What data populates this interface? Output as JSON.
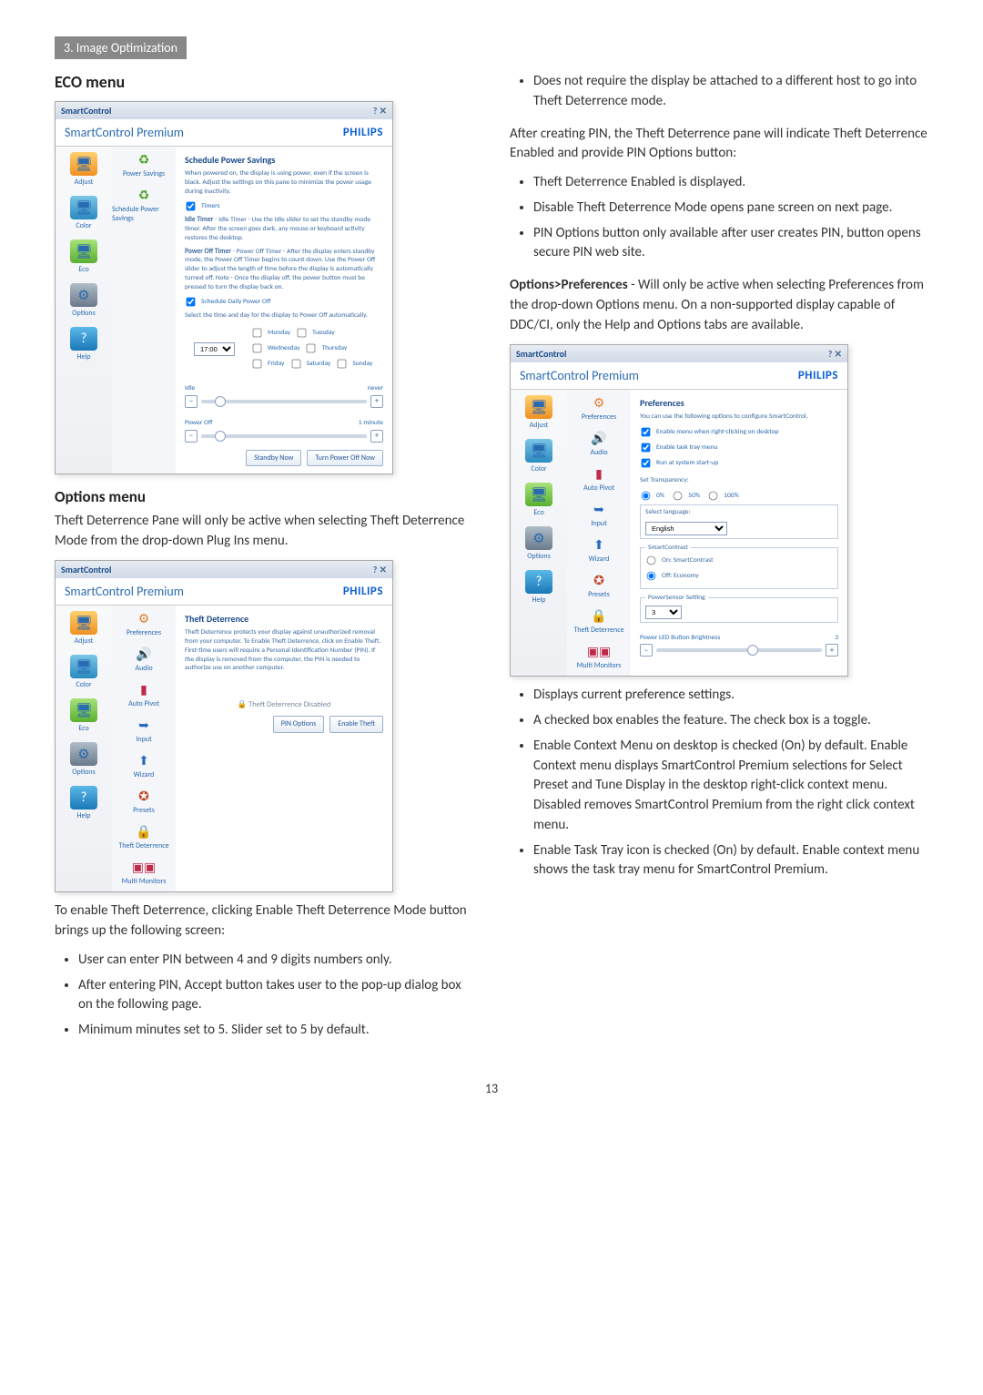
{
  "section_tag": "3. Image Optimization",
  "left": {
    "eco_heading": "ECO menu",
    "options_heading": "Options menu",
    "options_para": "Theft Deterrence Pane will only be active when selecting Theft Deterrence Mode from the drop-down Plug Ins menu.",
    "enable_para": "To enable Theft Deterrence, clicking Enable Theft Deterrence Mode button brings up the following screen:",
    "bullets": [
      "User can enter PIN between 4 and 9 digits numbers only.",
      "After entering PIN, Accept button takes user to the pop-up dialog box on the following page.",
      "Minimum minutes set to 5. Slider set to 5 by default."
    ]
  },
  "right": {
    "top_bullet": "Does not require the display be attached to a different host to go into Theft Deterrence mode.",
    "after_pin_para": "After creating PIN, the Theft Deterrence pane will indicate Theft Deterrence Enabled and provide PIN Options button:",
    "pin_bullets": [
      "Theft Deterrence Enabled is displayed.",
      "Disable Theft Deterrence Mode opens pane screen on next page.",
      "PIN Options button only available after user creates PIN, button opens secure PIN web site."
    ],
    "opts_pref_label": "Options>Preferences",
    "opts_pref_rest": " - Will only be active when selecting Preferences from the drop-down Options menu. On a non-supported display capable of DDC/CI, only the Help and Options tabs are available.",
    "pref_bullets": [
      "Displays current preference settings.",
      "A checked box enables the feature. The check box is a toggle.",
      "Enable Context Menu on desktop is checked (On) by default. Enable Context menu displays SmartControl Premium selections for Select Preset and Tune Display in the desktop right-click context menu. Disabled removes SmartControl Premium from the right click context menu.",
      "Enable Task Tray icon is checked (On) by default. Enable context menu shows the task tray menu for SmartControl Premium."
    ]
  },
  "page_number": "13",
  "app_common": {
    "titlebar": "SmartControl",
    "titlebar_right": "?  ✕",
    "product": "SmartControl Premium",
    "brand": "PHILIPS",
    "sidebar": {
      "adjust": "Adjust",
      "color": "Color",
      "eco": "Eco",
      "options": "Options",
      "help": "Help"
    }
  },
  "eco_panel": {
    "sub_item1": "Power Savings",
    "sub_item2": "Schedule Power Savings",
    "heading": "Schedule Power Savings",
    "p1": "When powered on, the display is using power, even if the screen is black. Adjust the settings on this pane to minimize the power usage during inactivity.",
    "timers_cb": "Timers",
    "idle": "Idle Timer - Use the Idle slider to set the standby mode timer. After the screen goes dark, any mouse or keyboard activity restores the desktop.",
    "pwroff": "Power Off Timer - After the display enters standby mode, the Power Off Timer begins to count down. Use the Power Off slider to adjust the length of time before the display is automatically turned off. Note - Once the display off, the power button must be pressed to turn the display back on.",
    "sched_cb": "Schedule Daily Power Off",
    "sched_p": "Select the time and day for the display to Power Off automatically.",
    "time_value": "17:00",
    "days": [
      "Monday",
      "Tuesday",
      "Wednesday",
      "Thursday",
      "Friday",
      "Saturday",
      "Sunday"
    ],
    "idle_label": "Idle",
    "idle_value": "never",
    "pwroff_label": "Power Off",
    "pwroff_value": "1 minute",
    "btn1": "Standby Now",
    "btn2": "Turn Power Off Now"
  },
  "theft_panel": {
    "sub": [
      "Preferences",
      "Audio",
      "Auto Pivot",
      "Input",
      "Wizard",
      "Presets",
      "Theft Deterrence",
      "Multi Monitors"
    ],
    "heading": "Theft Deterrence",
    "p1": "Theft Deterrence protects your display against unauthorized removal from your computer. To Enable Theft Deterrence, click on Enable Theft. First-time users will require a Personal Identification Number (PIN). If the display is removed from the computer, the PIN is needed to authorize use on another computer.",
    "status": "Theft Deterrence Disabled",
    "btn1": "PIN Options",
    "btn2": "Enable Theft"
  },
  "pref_panel": {
    "sub": [
      "Preferences",
      "Audio",
      "Auto Pivot",
      "Input",
      "Wizard",
      "Presets",
      "Theft Deterrence",
      "Multi Monitors"
    ],
    "heading": "Preferences",
    "p1": "You can use the following options to configure SmartControl.",
    "cb1": "Enable menu when right-clicking on desktop",
    "cb2": "Enable task tray menu",
    "cb3": "Run at system start-up",
    "trans_label": "Set Transparency:",
    "trans_opts": [
      "0%",
      "50%",
      "100%"
    ],
    "lang_label": "Select language:",
    "lang_value": "English",
    "sc_label": "SmartContrast",
    "sc_on": "On: SmartContrast",
    "sc_off": "Off: Economy",
    "ps_label": "PowerSensor Setting",
    "ps_value": "3",
    "led_label": "Power LED Button Brightness",
    "led_value": "3"
  }
}
